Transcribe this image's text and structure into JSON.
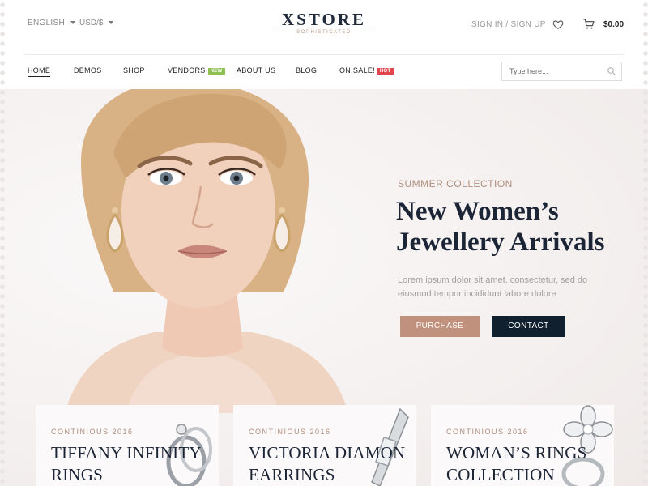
{
  "topbar": {
    "language": "ENGLISH",
    "currency": "USD/$",
    "sign_in": "SIGN IN / SIGN UP",
    "cart_total": "$0.00"
  },
  "logo": {
    "name": "XSTORE",
    "tagline": "SOPHISTICATED"
  },
  "nav": {
    "items": [
      {
        "label": "HOME"
      },
      {
        "label": "DEMOS"
      },
      {
        "label": "SHOP"
      },
      {
        "label": "VENDORS",
        "badge": "NEW"
      },
      {
        "label": "ABOUT US"
      },
      {
        "label": "BLOG"
      },
      {
        "label": "ON SALE!",
        "badge": "HOT"
      }
    ],
    "search_placeholder": "Type here..."
  },
  "hero": {
    "kicker": "SUMMER COLLECTION",
    "headline_line1": "New Women’s",
    "headline_line2": "Jewellery Arrivals",
    "description": "Lorem ipsum dolor sit amet, consectetur, sed do eiusmod tempor incididunt labore dolore",
    "purchase_label": "PURCHASE",
    "contact_label": "CONTACT"
  },
  "cards": [
    {
      "subtitle": "CONTINIOUS 2016",
      "title_line1": "TIFFANY INFINITY",
      "title_line2": "RINGS"
    },
    {
      "subtitle": "CONTINIOUS 2016",
      "title_line1": "VICTORIA DIAMON",
      "title_line2": "EARRINGS"
    },
    {
      "subtitle": "CONTINIOUS 2016",
      "title_line1": "WOMAN’S RINGS",
      "title_line2": "COLLECTION"
    }
  ],
  "colors": {
    "accent": "#c0917c",
    "dark": "#10202f",
    "heading": "#1c2536",
    "badge_new": "#8cc152",
    "badge_hot": "#e2464d"
  }
}
